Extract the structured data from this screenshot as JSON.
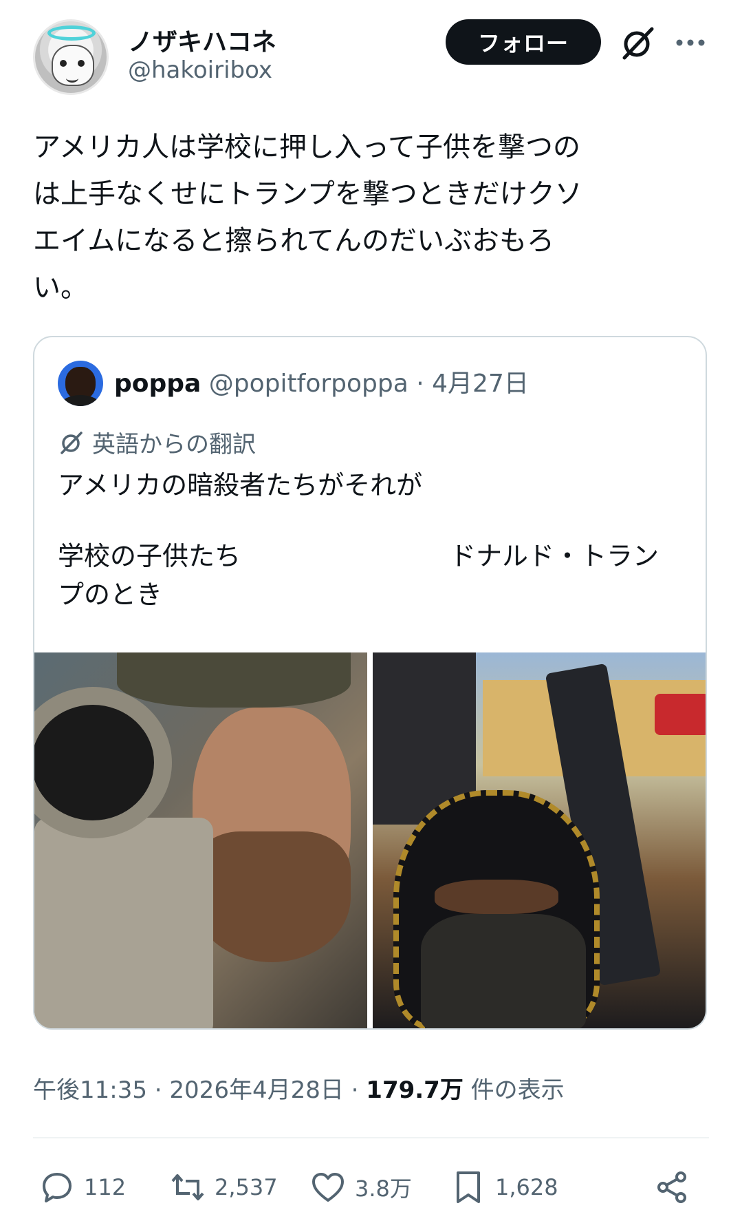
{
  "author": {
    "display_name": "ノザキハコネ",
    "handle": "@hakoiribox",
    "follow_label": "フォロー"
  },
  "tweet": {
    "text": "アメリカ人は学校に押し入って子供を撃つの\nは上手なくせにトランプを撃つときだけクソ\nエイムになると擦られてんのだいぶおもろ\nい。"
  },
  "quote": {
    "name": "poppa",
    "handle": "@popitforpoppa",
    "separator": "·",
    "date": "4月27日",
    "translate_label": "英語からの翻訳",
    "line1": "アメリカの暗殺者たちがそれが",
    "left_caption": "学校の子供たち",
    "right_caption": "ドナルド・トラン",
    "line3": "プのとき"
  },
  "meta": {
    "time": "午後11:35",
    "sep1": "·",
    "date": "2026年4月28日",
    "sep2": "·",
    "views": "179.7万",
    "views_suffix": "件の表示"
  },
  "actions": {
    "replies": "112",
    "reposts": "2,537",
    "likes": "3.8万",
    "bookmarks": "1,628"
  },
  "icons": [
    "grok-icon",
    "more-icon",
    "translate-icon",
    "reply-icon",
    "repost-icon",
    "like-icon",
    "bookmark-icon",
    "share-icon"
  ],
  "colors": {
    "text": "#0f1419",
    "secondary": "#536471",
    "border": "#cfd9de",
    "follow_bg": "#0f1419"
  }
}
